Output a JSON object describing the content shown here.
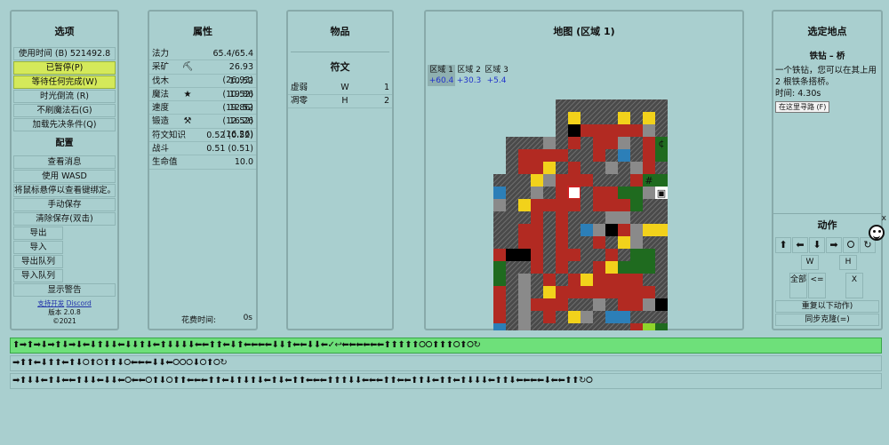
{
  "options": {
    "title": "选项",
    "buttons": [
      {
        "label": "使用时间 (B) 521492.8",
        "highlight": false
      },
      {
        "label": "已暂停(P)",
        "highlight": true
      },
      {
        "label": "等待任何完成(W)",
        "highlight": true
      },
      {
        "label": "时光倒流 (R)",
        "highlight": false
      },
      {
        "label": "不刷魔法石(G)",
        "highlight": false
      },
      {
        "label": "加载先决条件(Q)",
        "highlight": false
      }
    ],
    "config_title": "配置",
    "config_buttons": [
      {
        "label": "查看消息"
      },
      {
        "label": "使用 WASD"
      },
      {
        "label": "将鼠标悬停以查看键绑定。"
      },
      {
        "label": "手动保存"
      },
      {
        "label": "清除保存(双击)"
      }
    ],
    "small_buttons": [
      {
        "label": "导出"
      },
      {
        "label": "导入"
      },
      {
        "label": "导出队列"
      },
      {
        "label": "导入队列"
      }
    ],
    "warn_label": "显示警告",
    "footer_support": "支持开发",
    "footer_discord": "Discord",
    "footer_version": "版本 2.0.8",
    "footer_year": "©2021"
  },
  "attributes": {
    "title": "属性",
    "rows": [
      {
        "name": "法力",
        "icon": "",
        "value": "65.4/65.4"
      },
      {
        "name": "采矿",
        "icon": "⛏",
        "value": "26.93 (26.93)"
      },
      {
        "name": "伐木",
        "icon": "",
        "value": "10.52 (10.52)"
      },
      {
        "name": "魔法",
        "icon": "★",
        "value": "19.86 (19.86)"
      },
      {
        "name": "速度",
        "icon": "",
        "value": "12.52 (12.52)"
      },
      {
        "name": "锻造",
        "icon": "⚒",
        "value": "16.26 (16.26)"
      },
      {
        "name": "符文知识",
        "icon": "",
        "value": "0.52 (0.52)"
      },
      {
        "name": "战斗",
        "icon": "",
        "value": "0.51 (0.51)"
      },
      {
        "name": "生命值",
        "icon": "",
        "value": "10.0"
      }
    ],
    "time_spent_label": "花费时间:",
    "time_spent_value": "0s"
  },
  "items": {
    "title": "物品",
    "runes_title": "符文",
    "runes": [
      {
        "name": "虚弱",
        "key": "W",
        "count": "1"
      },
      {
        "name": "凋零",
        "key": "H",
        "count": "2"
      }
    ]
  },
  "map": {
    "title": "地图 (区域 1)",
    "zones": [
      {
        "name": "区域 1",
        "value": "+60.4",
        "active": true
      },
      {
        "name": "区域 2",
        "value": "+30.3",
        "active": false
      },
      {
        "name": "区域 3",
        "value": "+5.4",
        "active": false
      }
    ],
    "colors": {
      "wall": "#5a5a5a",
      "path": "#b22a22",
      "gold": "#f2d21b",
      "tree": "#1f6b1f",
      "blue": "#2c7fb8",
      "grey": "#8a8a8a",
      "black": "#000000",
      "lime": "#8fd42b"
    },
    "rows": [
      "......WWWWWWWWWW",
      "......WYWWWYWYWW",
      "......WKPPPPPGWW",
      "..WWWGWPWPPGWPDL",
      "..WPPPPWWPWBWPTW",
      "..WPPYWPWWGWGPWW",
      ".WWWYGPPPWWWPH#W",
      ".BWWGWPXWPPTTGSW",
      ".GWYPPPPWPPPTWW.",
      ".WWWPWPWWWGGWWW.",
      ".WWPPWPWBGKPGYY.",
      ".WWPPWPWWPWYGWW.",
      ".PKKPWPPWWPWTTW.",
      ".TWWPWPWWPYTTTW.",
      ".TWGWPWPYPPPPWW.",
      ".PWGWYPPPPPPPPW.",
      ".PWGPPPWWGWPPGKQ",
      ".PWGWPWYGWBBWWWW",
      ".BWGWWWWWWWWPVTR",
      ".WWWWWWWWWWWWWWW"
    ]
  },
  "selected": {
    "title": "选定地点",
    "name": "铁钻 – 桥",
    "desc": "一个铁钻，您可以在其上用 2 根铁条搭桥。",
    "time_label": "时间: 4.30s",
    "pathfind_button": "在这里寻路 (F)"
  },
  "actions": {
    "title": "动作",
    "arrows": [
      "⬆",
      "⬅",
      "⬇",
      "➡",
      "⭘",
      "↻"
    ],
    "rune_keys": [
      "W",
      "H"
    ],
    "all_label": "全部",
    "back_label": "<=",
    "close_label": "X",
    "repeat_label": "重复以下动作)",
    "sync_label": "同步克隆(=)",
    "x_small": "x"
  },
  "queues": [
    {
      "active": true,
      "text": "⬆➡⬆➡⬇➡⬆⬇➡⬇⬅⬇⬆⬇⬇⬅⬇⬇⬆⬇⬅⬆⬇⬇⬇⬇⬅⬅⬆⬆⬅⬇⬆⬅⬅⬅⬅⬇⬇⬆⬅⬅⬇⬇⬅✓↩⬅⬅⬅⬅⬅⬅⬆⬆⬆⬆⬆⭘⭘⬆⬆⬆⭘⬆⭘↻"
    },
    {
      "active": false,
      "text": "➡⬆⬆⬅⬇⬆⬆⬅⬆⬇⭘⬆⭘⬆⬆⬇⭘⬅⬅⬅⬇⬇⬅⭘⭘⭘⬇⭘⬆⭘↻"
    },
    {
      "active": false,
      "text": "➡⬆⬇⬇⬅⬆⬇⬅⬅⬆⬇⬇⬅⬇⬇⬅⭘⬅⬅⭘⬆⬇⭘⬆⬆⬅⬅⬅⬆⬆⬅⬇⬆⬇⬆⬇⬅⬆⬇⬅⬆⬆⬅⬅⬅⬆⬆⬆⬇⬇⬅⬅⬅⬆⬆⬅⬅⬆⬆⬇⬅⬆⬆⬅⬆⬇⬇⬇⬅⬆⬆⬇⬅⬅⬅⬅⬇⬅⬅⬆⬆↻⭘"
    }
  ]
}
